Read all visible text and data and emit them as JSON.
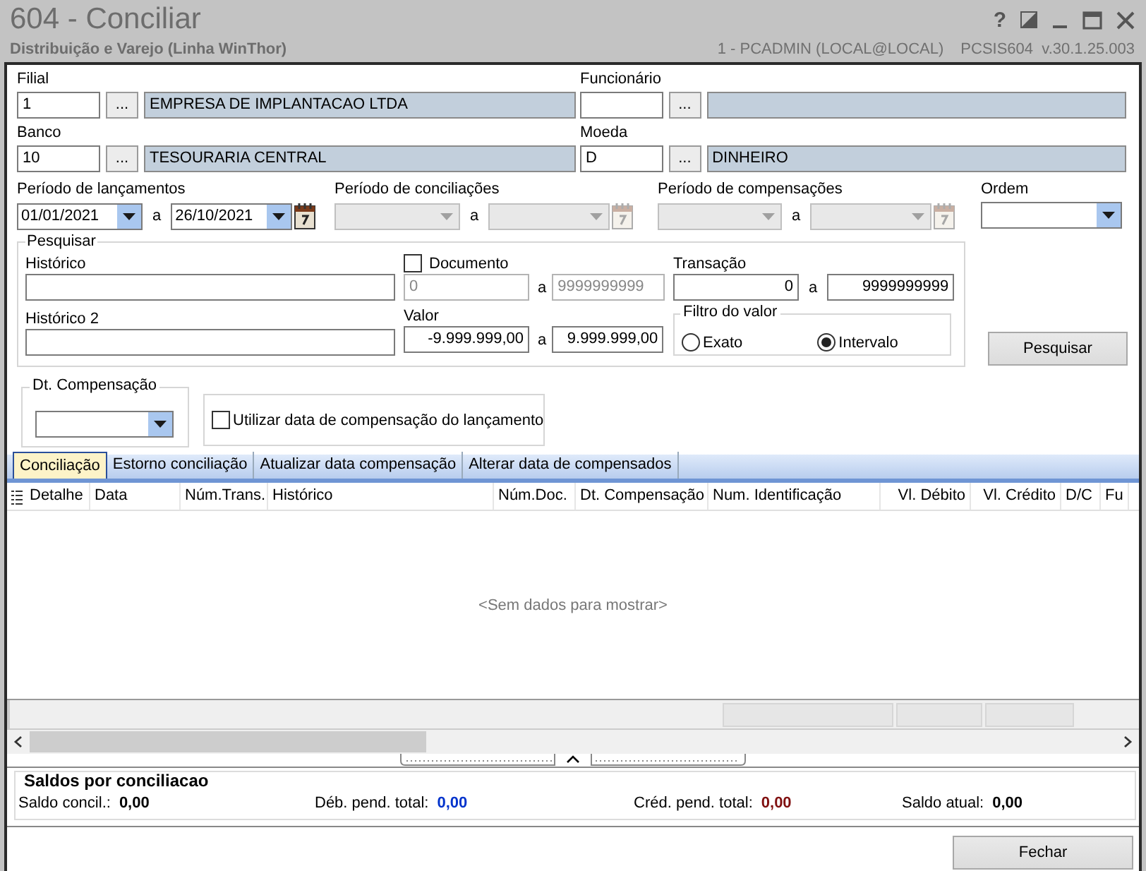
{
  "window": {
    "title": "604 - Conciliar",
    "subtitle": "Distribuição e Varejo (Linha WinThor)",
    "help": "?",
    "user": "1 - PCADMIN (LOCAL@LOCAL)",
    "version": "PCSIS604  v.30.1.25.003"
  },
  "lookups": [
    {
      "label": "Filial",
      "code": "1",
      "name": "EMPRESA DE IMPLANTACAO LTDA",
      "button": "..."
    },
    {
      "label": "Funcionário",
      "button": "..."
    },
    {
      "label": "Banco",
      "code": "10",
      "name": "TESOURARIA CENTRAL",
      "button": "..."
    },
    {
      "label": "Moeda",
      "code": "D",
      "name": "DINHEIRO",
      "button": "..."
    }
  ],
  "periods": [
    {
      "label": "Período de lançamentos",
      "from": "01/01/2021",
      "sep": "a",
      "to": "26/10/2021",
      "disabled": false
    },
    {
      "label": "Período de conciliações",
      "sep": "a",
      "disabled": true
    },
    {
      "label": "Período de compensações",
      "sep": "a",
      "disabled": true
    }
  ],
  "ordem": {
    "label": "Ordem"
  },
  "pesquisar": {
    "title": "Pesquisar",
    "historico": {
      "label": "Histórico"
    },
    "documento": {
      "label": "Documento",
      "checked": false,
      "from": "0",
      "sep": "a",
      "to": "9999999999"
    },
    "transacao": {
      "label": "Transação",
      "from": "0",
      "sep": "a",
      "to": "9999999999"
    },
    "historico2": {
      "label": "Histórico 2"
    },
    "valor": {
      "label": "Valor",
      "from": "-9.999.999,00",
      "sep": "a",
      "to": "9.999.999,00"
    },
    "filtro": {
      "title": "Filtro do valor",
      "options": [
        {
          "label": "Exato",
          "selected": false
        },
        {
          "label": "Intervalo",
          "selected": true
        }
      ]
    }
  },
  "search_button": "Pesquisar",
  "dt_compensacao": {
    "label": "Dt. Compensação"
  },
  "utilizar": {
    "label": "Utilizar data de compensação do lançamento",
    "checked": false
  },
  "tabs": [
    {
      "label": "Conciliação",
      "selected": true
    },
    {
      "label": "Estorno conciliação",
      "selected": false
    },
    {
      "label": "Atualizar data compensação",
      "selected": false
    },
    {
      "label": "Alterar data de compensados",
      "selected": false
    }
  ],
  "table": {
    "columns": [
      {
        "label": "Detalhe"
      },
      {
        "label": "Data"
      },
      {
        "label": "Núm.Trans."
      },
      {
        "label": "Histórico"
      },
      {
        "label": "Núm.Doc."
      },
      {
        "label": "Dt. Compensação"
      },
      {
        "label": "Num. Identificação"
      },
      {
        "label": "Vl. Débito"
      },
      {
        "label": "Vl. Crédito"
      },
      {
        "label": "D/C"
      },
      {
        "label": "Fu"
      }
    ],
    "empty_text": "<Sem dados para mostrar>"
  },
  "totals": {
    "title": "Saldos por conciliacao",
    "items": [
      {
        "label": "Saldo concil.:",
        "value": "0,00",
        "color": "#000000"
      },
      {
        "label": "Déb. pend. total:",
        "value": "0,00",
        "color": "#0033cc"
      },
      {
        "label": "Créd. pend. total:",
        "value": "0,00",
        "color": "#801010"
      },
      {
        "label": "Saldo atual:",
        "value": "0,00",
        "color": "#000000"
      }
    ]
  },
  "close_button": "Fechar"
}
